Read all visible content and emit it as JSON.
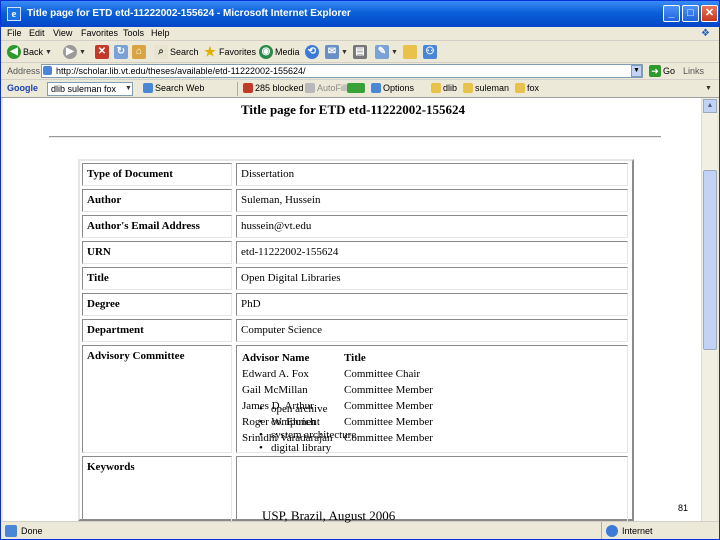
{
  "window": {
    "title": "Title page for ETD etd-11222002-155624 - Microsoft Internet Explorer",
    "app_icon": "internet-explorer-icon"
  },
  "menu": [
    "File",
    "Edit",
    "View",
    "Favorites",
    "Tools",
    "Help"
  ],
  "toolbar": {
    "back": "Back",
    "search": "Search",
    "favorites": "Favorites",
    "media": "Media"
  },
  "address": {
    "label": "Address",
    "url": "http://scholar.lib.vt.edu/theses/available/etd-11222002-155624/",
    "go": "Go",
    "links": "Links"
  },
  "googlebar": {
    "logo": "Google",
    "query": "dlib suleman fox",
    "search_web": "Search Web",
    "blocked": "285 blocked",
    "autofill": "AutoFill",
    "options": "Options",
    "terms": [
      "dlib",
      "suleman",
      "fox"
    ]
  },
  "page": {
    "title": "Title page for ETD etd-11222002-155624",
    "rows": [
      {
        "label": "Type of Document",
        "value": "Dissertation"
      },
      {
        "label": "Author",
        "value": "Suleman, Hussein"
      },
      {
        "label": "Author's Email Address",
        "value": "hussein@vt.edu"
      },
      {
        "label": "URN",
        "value": "etd-11222002-155624"
      },
      {
        "label": "Title",
        "value": "Open Digital Libraries"
      },
      {
        "label": "Degree",
        "value": "PhD"
      },
      {
        "label": "Department",
        "value": "Computer Science"
      }
    ],
    "committee": {
      "label": "Advisory Committee",
      "header_name": "Advisor Name",
      "header_title": "Title",
      "members": [
        {
          "name": "Edward A. Fox",
          "title": "Committee Chair"
        },
        {
          "name": "Gail McMillan",
          "title": "Committee Member"
        },
        {
          "name": "James D. Arthur",
          "title": "Committee Member"
        },
        {
          "name": "Roger W. Ehrich",
          "title": "Committee Member"
        },
        {
          "name": "Srinidhi Varadarajan",
          "title": "Committee Member"
        }
      ]
    },
    "keywords": {
      "label": "Keywords",
      "items": [
        "open archive",
        "component",
        "system architecture",
        "digital library"
      ]
    }
  },
  "status": {
    "text": "Done",
    "zone": "Internet"
  },
  "slide": {
    "caption": "USP, Brazil, August 2006",
    "number": "81"
  }
}
